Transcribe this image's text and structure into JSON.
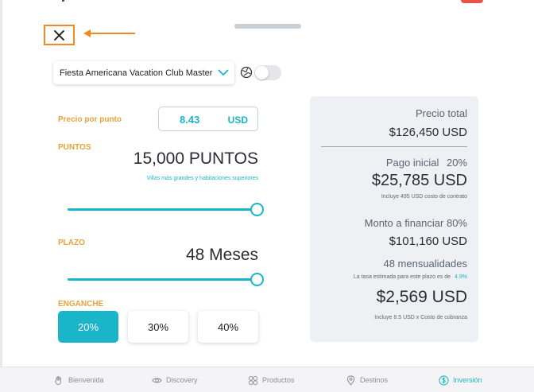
{
  "close": {
    "icon": "close-icon"
  },
  "property_select": {
    "selected": "Fiesta Americana Vacation Club Master",
    "icon": "chevron-down-icon"
  },
  "price": {
    "label": "Precio por punto",
    "value": "8.43",
    "currency": "USD"
  },
  "points": {
    "label": "PUNTOS",
    "value": "15,000 PUNTOS",
    "subtitle": "Villas más grandes y habitaciones superiores",
    "slider_fraction": 1.0
  },
  "term": {
    "label": "PLAZO",
    "value": "48 Meses",
    "slider_fraction": 1.0
  },
  "down_payment": {
    "label": "ENGANCHE",
    "options": [
      "20%",
      "30%",
      "40%"
    ],
    "selected": "20%"
  },
  "summary": {
    "total_label": "Precio total",
    "total_value": "$126,450 USD",
    "initial_label": "Pago inicial",
    "initial_pct": "20%",
    "initial_value": "$25,785 USD",
    "initial_note": "Incluye  495 USD costo de contrato",
    "finance_label": "Monto a financiar 80%",
    "finance_value": "$101,160 USD",
    "installments_label": "48 mensualidades",
    "rate_note": "La tasa estimada para este plazo es de",
    "rate_value": "4.9%",
    "monthly_value": "$2,569 USD",
    "monthly_note": "Incluye 8.5 USD x Costo de cobranza"
  },
  "nav": [
    {
      "label": "Bienvenida",
      "icon": "hand-icon"
    },
    {
      "label": "Discovery",
      "icon": "eye-icon"
    },
    {
      "label": "Productos",
      "icon": "grid-icon"
    },
    {
      "label": "Destinos",
      "icon": "location-pin-icon"
    },
    {
      "label": "Inversión",
      "icon": "dollar-circle-icon"
    }
  ],
  "colors": {
    "accent": "#1bb5c9",
    "label_orange": "#e8a33c",
    "highlight_orange": "#f08a24"
  }
}
